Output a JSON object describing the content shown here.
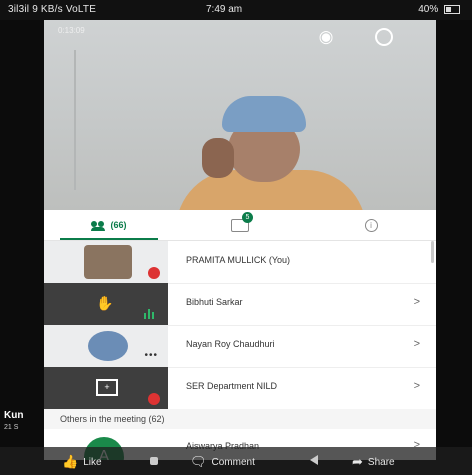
{
  "statusbar": {
    "left": "3il3il 9 KB/s VoLTE",
    "time": "7:49 am",
    "right": "40%"
  },
  "video": {
    "meeting_label": "0:13:09",
    "icons": {
      "tag": "tag-icon",
      "pin": "pin-icon",
      "more": "more-vertical-icon"
    }
  },
  "tabs": [
    {
      "label": "(66)",
      "icon": "people-icon"
    },
    {
      "label": "",
      "icon": "chat-icon",
      "badge": "5"
    },
    {
      "label": "",
      "icon": "info-icon"
    }
  ],
  "participants": [
    {
      "name": "PRAMITA MULLICK (You)",
      "chevron": "",
      "tile": "video",
      "status": "muted"
    },
    {
      "name": "Bibhuti Sarkar",
      "chevron": ">",
      "tile": "raised-hand",
      "status": "speaking"
    },
    {
      "name": "Nayan Roy Chaudhuri",
      "chevron": ">",
      "tile": "avatar",
      "status": "more"
    },
    {
      "name": "SER Department NILD",
      "chevron": ">",
      "tile": "presentation",
      "status": "muted"
    }
  ],
  "others_section": "Others in the meeting (62)",
  "last_participant": {
    "initial": "A",
    "name": "Aiswarya Pradhan",
    "chevron": ">"
  },
  "feed": {
    "name": "Kun",
    "time": "21 S"
  },
  "actions": {
    "like": "Like",
    "comment": "Comment",
    "share": "Share"
  },
  "colors": {
    "accent": "#0b7c4a",
    "mute": "#dd3333",
    "speaking": "#2fb86a"
  }
}
